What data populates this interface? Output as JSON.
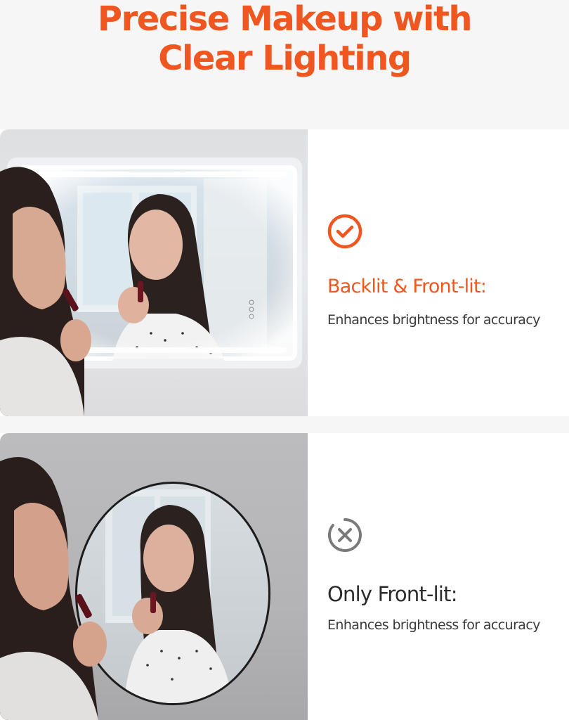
{
  "headline": {
    "line1": "Precise Makeup with",
    "line2": "Clear Lighting"
  },
  "colors": {
    "accent": "#f0561f",
    "panel_background": "#ffffff",
    "page_background": "#f6f6f6",
    "dark_text": "#2b2b2b",
    "icon_gray": "#7a7a7a"
  },
  "comparisons": [
    {
      "icon": "check-circle-icon",
      "title": "Backlit & Front-lit:",
      "description": "Enhances brightness for accuracy"
    },
    {
      "icon": "x-circle-icon",
      "title": "Only Front-lit:",
      "description": "Enhances brightness for accuracy"
    }
  ]
}
